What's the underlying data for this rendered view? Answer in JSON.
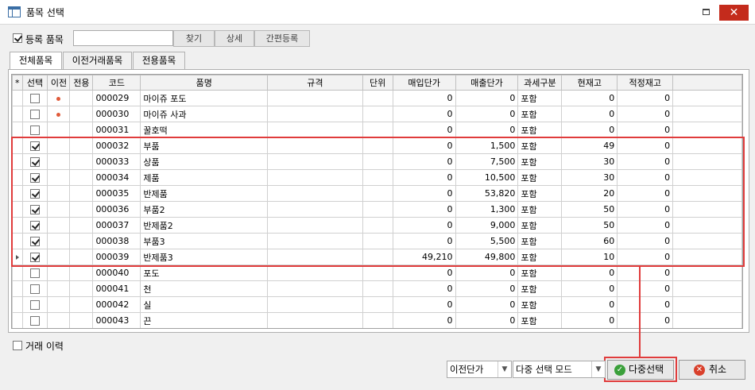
{
  "window": {
    "title": "품목 선택",
    "close_glyph": "✕"
  },
  "toolbar": {
    "registered_label": "등록 품목",
    "registered_checked": true,
    "search_value": "",
    "find_label": "찾기",
    "detail_label": "상세",
    "quick_register_label": "간편등록"
  },
  "tabs": [
    {
      "label": "전체품목",
      "active": true
    },
    {
      "label": "이전거래품목",
      "active": false
    },
    {
      "label": "전용품목",
      "active": false
    }
  ],
  "grid": {
    "corner": "*",
    "columns": [
      "선택",
      "이전",
      "전용",
      "코드",
      "품명",
      "규격",
      "단위",
      "매입단가",
      "매출단가",
      "과세구분",
      "현재고",
      "적정재고"
    ],
    "rows": [
      {
        "selected": false,
        "prev": true,
        "code": "000029",
        "name": "마이쥬 포도",
        "spec": "",
        "unit": "",
        "buy": "0",
        "sell": "0",
        "tax": "포함",
        "stock": "0",
        "proper": "0"
      },
      {
        "selected": false,
        "prev": true,
        "code": "000030",
        "name": "마이쥬 사과",
        "spec": "",
        "unit": "",
        "buy": "0",
        "sell": "0",
        "tax": "포함",
        "stock": "0",
        "proper": "0"
      },
      {
        "selected": false,
        "prev": false,
        "code": "000031",
        "name": "꿀호떡",
        "spec": "",
        "unit": "",
        "buy": "0",
        "sell": "0",
        "tax": "포함",
        "stock": "0",
        "proper": "0"
      },
      {
        "selected": true,
        "prev": false,
        "code": "000032",
        "name": "부품",
        "spec": "",
        "unit": "",
        "buy": "0",
        "sell": "1,500",
        "tax": "포함",
        "stock": "49",
        "proper": "0"
      },
      {
        "selected": true,
        "prev": false,
        "code": "000033",
        "name": "상품",
        "spec": "",
        "unit": "",
        "buy": "0",
        "sell": "7,500",
        "tax": "포함",
        "stock": "30",
        "proper": "0"
      },
      {
        "selected": true,
        "prev": false,
        "code": "000034",
        "name": "제품",
        "spec": "",
        "unit": "",
        "buy": "0",
        "sell": "10,500",
        "tax": "포함",
        "stock": "30",
        "proper": "0"
      },
      {
        "selected": true,
        "prev": false,
        "code": "000035",
        "name": "반제품",
        "spec": "",
        "unit": "",
        "buy": "0",
        "sell": "53,820",
        "tax": "포함",
        "stock": "20",
        "proper": "0"
      },
      {
        "selected": true,
        "prev": false,
        "code": "000036",
        "name": "부품2",
        "spec": "",
        "unit": "",
        "buy": "0",
        "sell": "1,300",
        "tax": "포함",
        "stock": "50",
        "proper": "0"
      },
      {
        "selected": true,
        "prev": false,
        "code": "000037",
        "name": "반제품2",
        "spec": "",
        "unit": "",
        "buy": "0",
        "sell": "9,000",
        "tax": "포함",
        "stock": "50",
        "proper": "0"
      },
      {
        "selected": true,
        "prev": false,
        "code": "000038",
        "name": "부품3",
        "spec": "",
        "unit": "",
        "buy": "0",
        "sell": "5,500",
        "tax": "포함",
        "stock": "60",
        "proper": "0"
      },
      {
        "selected": true,
        "prev": false,
        "current": true,
        "code": "000039",
        "name": "반제품3",
        "spec": "",
        "unit": "",
        "buy": "49,210",
        "sell": "49,800",
        "tax": "포함",
        "stock": "10",
        "proper": "0"
      },
      {
        "selected": false,
        "prev": false,
        "code": "000040",
        "name": "포도",
        "spec": "",
        "unit": "",
        "buy": "0",
        "sell": "0",
        "tax": "포함",
        "stock": "0",
        "proper": "0"
      },
      {
        "selected": false,
        "prev": false,
        "code": "000041",
        "name": "천",
        "spec": "",
        "unit": "",
        "buy": "0",
        "sell": "0",
        "tax": "포함",
        "stock": "0",
        "proper": "0"
      },
      {
        "selected": false,
        "prev": false,
        "code": "000042",
        "name": "실",
        "spec": "",
        "unit": "",
        "buy": "0",
        "sell": "0",
        "tax": "포함",
        "stock": "0",
        "proper": "0"
      },
      {
        "selected": false,
        "prev": false,
        "code": "000043",
        "name": "끈",
        "spec": "",
        "unit": "",
        "buy": "0",
        "sell": "0",
        "tax": "포함",
        "stock": "0",
        "proper": "0"
      }
    ]
  },
  "footer": {
    "history_label": "거래 이력",
    "history_checked": false,
    "price_select": "이전단가",
    "mode_select": "다중 선택 모드",
    "multi_select_label": "다중선택",
    "cancel_label": "취소"
  },
  "colors": {
    "highlight": "#e03c3c",
    "close": "#c42b1c",
    "ok_icon": "#3aa03a",
    "cancel_icon": "#d9402b",
    "prev_dot": "#e05a3a"
  }
}
